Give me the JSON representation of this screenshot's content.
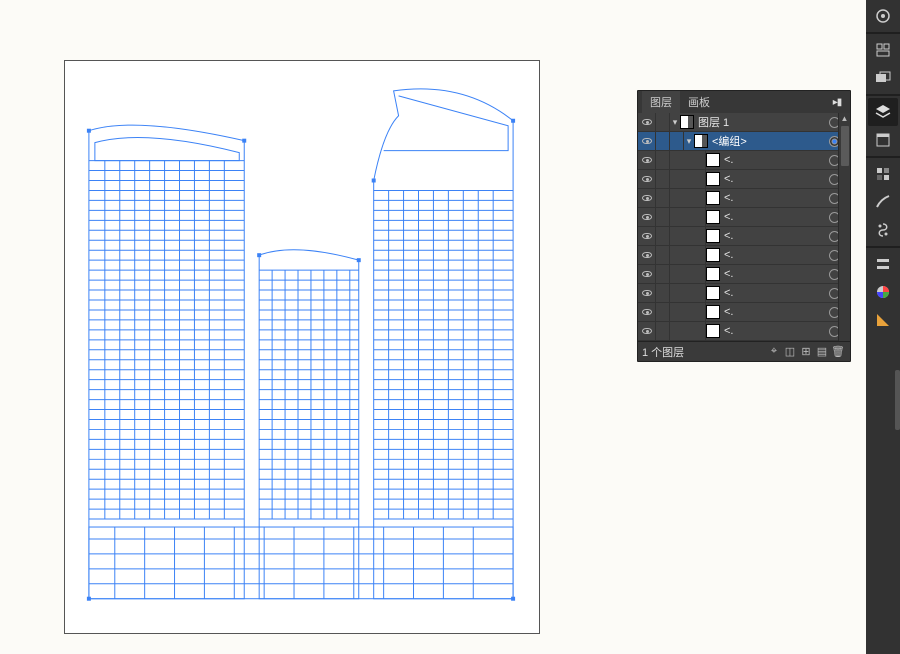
{
  "panel": {
    "tabs": {
      "layers": "图层",
      "artboards": "画板"
    },
    "layer_label": "图层 1",
    "group_label": "<编组>",
    "path_label": "<.",
    "status": "1 个图层",
    "flyout": "▸▮"
  },
  "rail": {
    "tools": [
      "properties-icon",
      "align-icon",
      "transform-icon",
      "layers-icon",
      "libraries-icon",
      "swatches-icon",
      "brushes-icon",
      "symbols-icon",
      "stroke-icon",
      "color-icon",
      "color-guide-icon"
    ]
  }
}
